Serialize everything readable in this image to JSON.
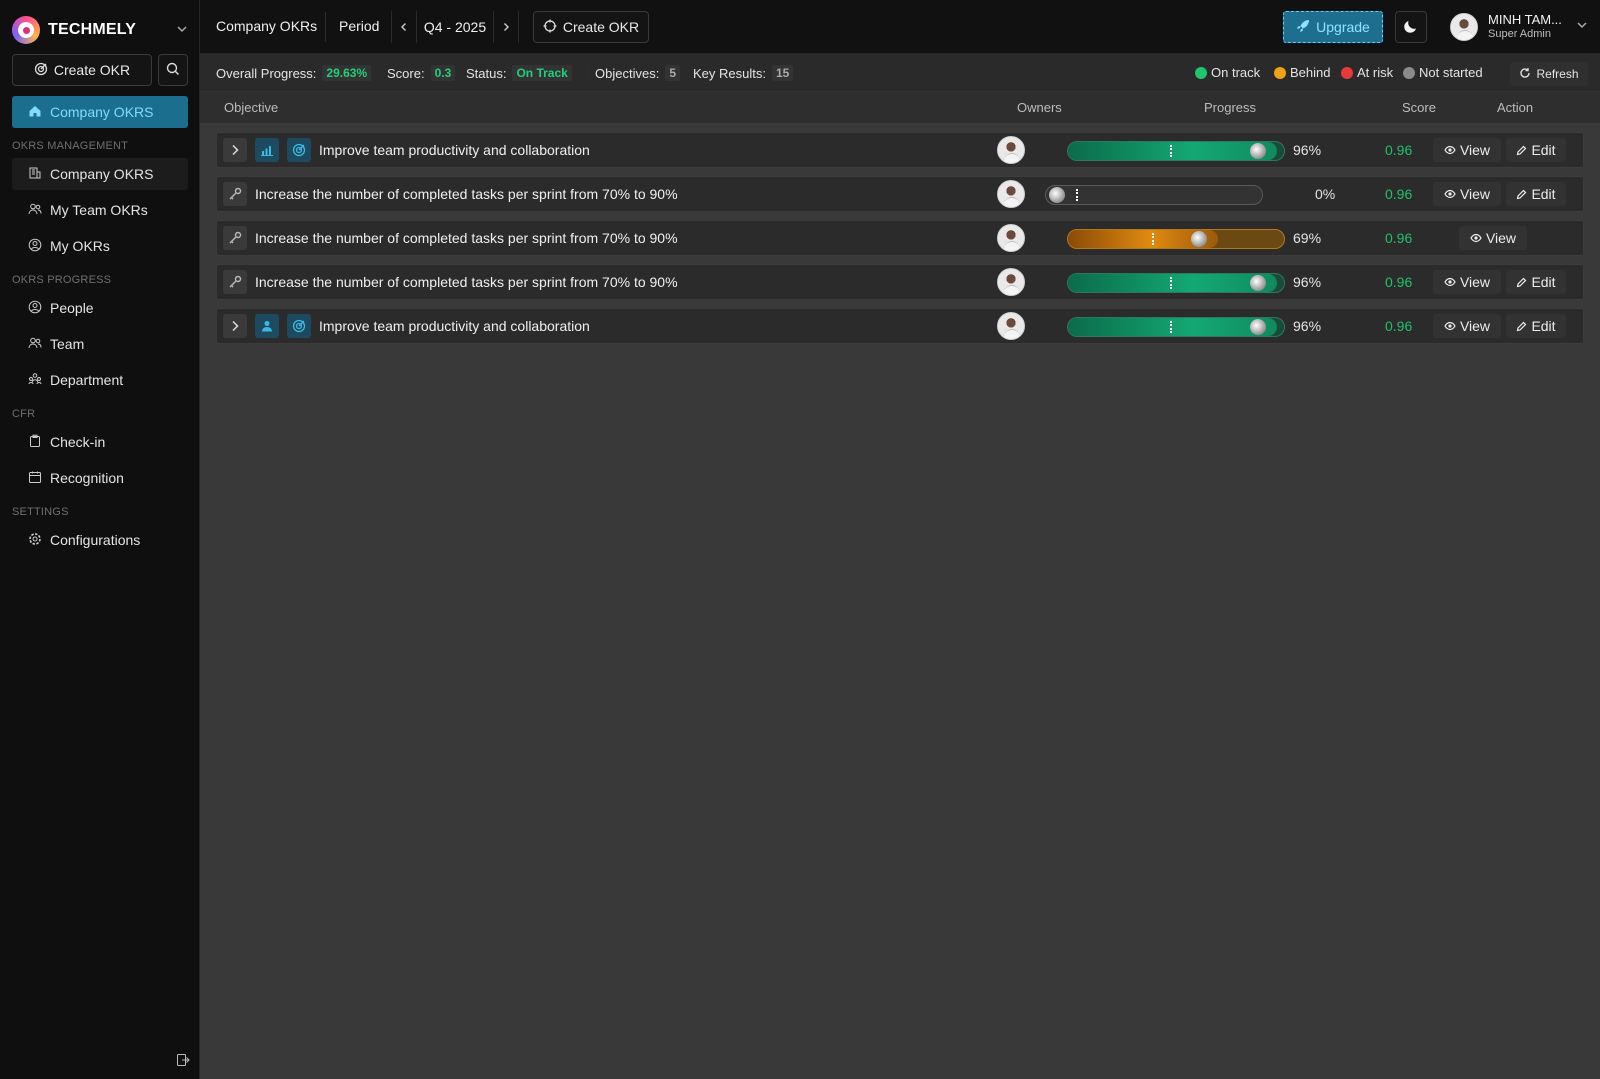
{
  "brand": {
    "name": "TECHMELY"
  },
  "sidebar": {
    "create_label": "Create OKR",
    "active_label": "Company OKRS",
    "sections": [
      {
        "title": "OKRS MANAGEMENT",
        "items": [
          {
            "label": "Company OKRS",
            "icon": "building-icon"
          },
          {
            "label": "My Team OKRs",
            "icon": "team-icon"
          },
          {
            "label": "My OKRs",
            "icon": "user-circle-icon"
          }
        ]
      },
      {
        "title": "OKRS PROGRESS",
        "items": [
          {
            "label": "People",
            "icon": "user-circle-icon"
          },
          {
            "label": "Team",
            "icon": "team-icon"
          },
          {
            "label": "Department",
            "icon": "department-icon"
          }
        ]
      },
      {
        "title": "CFR",
        "items": [
          {
            "label": "Check-in",
            "icon": "clipboard-icon"
          },
          {
            "label": "Recognition",
            "icon": "calendar-icon"
          }
        ]
      },
      {
        "title": "SETTINGS",
        "items": [
          {
            "label": "Configurations",
            "icon": "gear-icon"
          }
        ]
      }
    ]
  },
  "topbar": {
    "title": "Company OKRs",
    "period_label": "Period",
    "period_value": "Q4 - 2025",
    "create_label": "Create OKR",
    "upgrade_label": "Upgrade",
    "user_name": "MINH TAM...",
    "user_role": "Super Admin"
  },
  "stats": {
    "overall_label": "Overall Progress:",
    "overall_value": "29.63%",
    "score_label": "Score:",
    "score_value": "0.3",
    "status_label": "Status:",
    "status_value": "On Track",
    "objectives_label": "Objectives:",
    "objectives_value": "5",
    "kr_label": "Key Results:",
    "kr_value": "15",
    "legend": [
      {
        "label": "On track",
        "color": "#1fc56b"
      },
      {
        "label": "Behind",
        "color": "#f0a216"
      },
      {
        "label": "At risk",
        "color": "#e83a3a"
      },
      {
        "label": "Not started",
        "color": "#8a8a8a"
      }
    ],
    "refresh_label": "Refresh"
  },
  "table": {
    "headers": {
      "objective": "Objective",
      "owners": "Owners",
      "progress": "Progress",
      "score": "Score",
      "action": "Action"
    },
    "rows": [
      {
        "type": "objective",
        "title": "Improve team productivity and collaboration",
        "progress": 0.96,
        "pct": "96%",
        "score": "0.96",
        "status": "green",
        "can_edit": true,
        "icon": "chart-icon"
      },
      {
        "type": "kr",
        "title": "Increase the number of completed tasks per sprint from 70% to 90%",
        "progress": 0.0,
        "pct": "0%",
        "score": "0.96",
        "status": "gray",
        "can_edit": true
      },
      {
        "type": "kr",
        "title": "Increase the number of completed tasks per sprint from 70% to 90%",
        "progress": 0.69,
        "pct": "69%",
        "score": "0.96",
        "status": "orange",
        "can_edit": false
      },
      {
        "type": "kr",
        "title": "Increase the number of completed tasks per sprint from 70% to 90%",
        "progress": 0.96,
        "pct": "96%",
        "score": "0.96",
        "status": "green",
        "can_edit": true
      },
      {
        "type": "objective",
        "title": "Improve team productivity and collaboration",
        "progress": 0.96,
        "pct": "96%",
        "score": "0.96",
        "status": "green",
        "can_edit": true,
        "icon": "person-icon"
      }
    ],
    "view_label": "View",
    "edit_label": "Edit"
  }
}
